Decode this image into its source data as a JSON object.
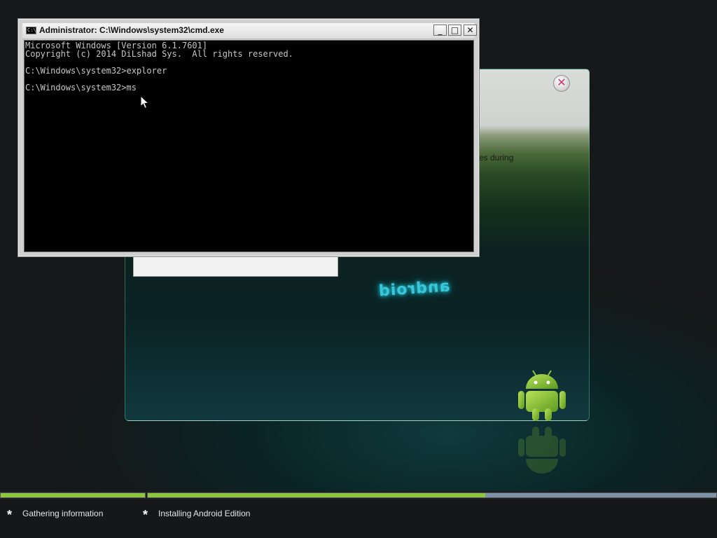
{
  "setup_dialog": {
    "partial_text": "es during",
    "close_glyph": "✕",
    "brand_text": "android"
  },
  "cmd": {
    "title": "Administrator: C:\\Windows\\system32\\cmd.exe",
    "icon_label": "C:\\",
    "minimize_glyph": "_",
    "maximize_glyph": "□",
    "close_glyph": "✕",
    "lines": [
      "Microsoft Windows [Version 6.1.7601]",
      "Copyright (c) 2014 DiLshad Sys.  All rights reserved.",
      "",
      "C:\\Windows\\system32>explorer",
      "",
      "C:\\Windows\\system32>ms"
    ]
  },
  "progress": {
    "step1_fraction": 1.0,
    "step2_fraction": 0.593,
    "fill_color": "#8dc63f",
    "track_color": "#7d93a8"
  },
  "steps": [
    {
      "bullet": "*",
      "label": "Gathering information"
    },
    {
      "bullet": "*",
      "label": "Installing Android Edition"
    }
  ],
  "icons": {
    "cmd_icon": "console-icon",
    "cursor": "mouse-pointer-icon",
    "robot": "android-robot-icon"
  }
}
